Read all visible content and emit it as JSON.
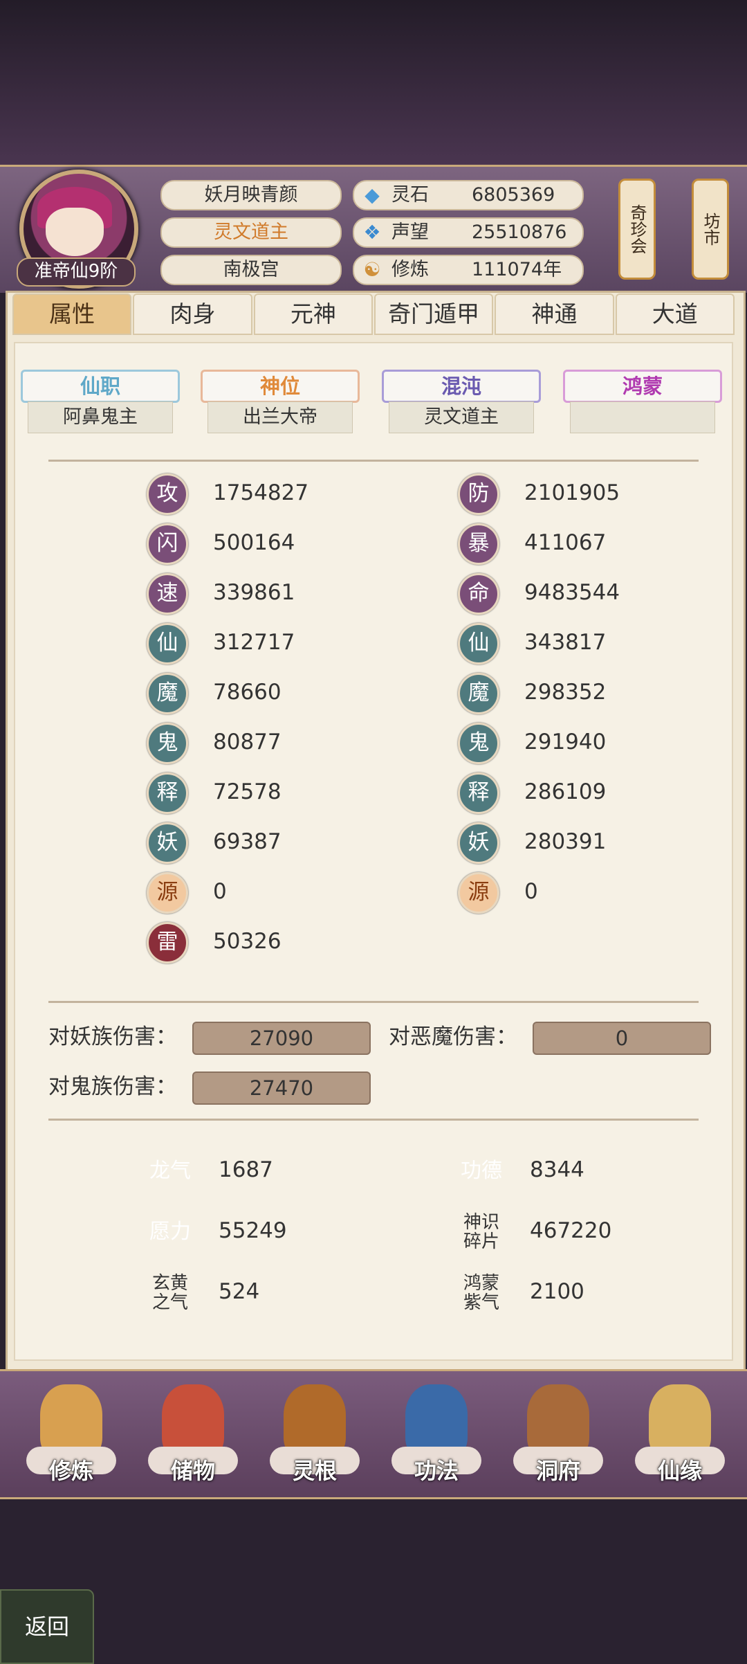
{
  "player": {
    "rank": "准帝仙9阶",
    "name": "妖月映青颜",
    "title": "灵文道主",
    "sect": "南极宫"
  },
  "resources": [
    {
      "icon": "spirit-stone-icon",
      "label": "灵石",
      "value": "6805369"
    },
    {
      "icon": "reputation-icon",
      "label": "声望",
      "value": "25510876"
    },
    {
      "icon": "cultivation-icon",
      "label": "修炼",
      "value": "111074年"
    }
  ],
  "side_buttons": {
    "treasure": "奇珍会",
    "market": "坊市"
  },
  "tabs": [
    "属性",
    "肉身",
    "元神",
    "奇门遁甲",
    "神通",
    "大道"
  ],
  "titles": [
    {
      "label": "仙职",
      "value": "阿鼻鬼主",
      "color": "#5fa8c8"
    },
    {
      "label": "神位",
      "value": "出兰大帝",
      "color": "#e08a3a"
    },
    {
      "label": "混沌",
      "value": "灵文道主",
      "color": "#6a5ab0"
    },
    {
      "label": "鸿蒙",
      "value": "",
      "color": "#b03ab0"
    }
  ],
  "stats_left": [
    {
      "icon": "攻",
      "value": "1754827",
      "style": ""
    },
    {
      "icon": "闪",
      "value": "500164",
      "style": ""
    },
    {
      "icon": "速",
      "value": "339861",
      "style": ""
    },
    {
      "icon": "仙",
      "value": "312717",
      "style": "teal"
    },
    {
      "icon": "魔",
      "value": "78660",
      "style": "teal"
    },
    {
      "icon": "鬼",
      "value": "80877",
      "style": "teal"
    },
    {
      "icon": "释",
      "value": "72578",
      "style": "teal"
    },
    {
      "icon": "妖",
      "value": "69387",
      "style": "teal"
    },
    {
      "icon": "源",
      "value": "0",
      "style": "orange"
    },
    {
      "icon": "雷",
      "value": "50326",
      "style": "red"
    }
  ],
  "stats_right": [
    {
      "icon": "防",
      "value": "2101905",
      "style": ""
    },
    {
      "icon": "暴",
      "value": "411067",
      "style": ""
    },
    {
      "icon": "命",
      "value": "9483544",
      "style": ""
    },
    {
      "icon": "仙",
      "value": "343817",
      "style": "teal"
    },
    {
      "icon": "魔",
      "value": "298352",
      "style": "teal"
    },
    {
      "icon": "鬼",
      "value": "291940",
      "style": "teal"
    },
    {
      "icon": "释",
      "value": "286109",
      "style": "teal"
    },
    {
      "icon": "妖",
      "value": "280391",
      "style": "teal"
    },
    {
      "icon": "源",
      "value": "0",
      "style": "orange"
    }
  ],
  "damage": {
    "vs_yao_label": "对妖族伤害：",
    "vs_yao_value": "27090",
    "vs_demon_label": "对恶魔伤害：",
    "vs_demon_value": "0",
    "vs_ghost_label": "对鬼族伤害：",
    "vs_ghost_value": "27470"
  },
  "misc": [
    {
      "label": "龙气",
      "value": "1687",
      "diamond": true
    },
    {
      "label": "功德",
      "value": "8344",
      "diamond": true
    },
    {
      "label": "愿力",
      "value": "55249",
      "diamond": true
    },
    {
      "label": "神识碎片",
      "value": "467220",
      "diamond": false
    },
    {
      "label": "玄黄之气",
      "value": "524",
      "diamond": false
    },
    {
      "label": "鸿蒙紫气",
      "value": "2100",
      "diamond": false
    }
  ],
  "nav": [
    {
      "label": "修炼",
      "icon": "monk-icon",
      "color": "#d8a050"
    },
    {
      "label": "储物",
      "icon": "bag-icon",
      "color": "#c8503a"
    },
    {
      "label": "灵根",
      "icon": "root-icon",
      "color": "#b06a2a"
    },
    {
      "label": "功法",
      "icon": "book-icon",
      "color": "#3a6aa8"
    },
    {
      "label": "洞府",
      "icon": "house-icon",
      "color": "#a86a3a"
    },
    {
      "label": "仙缘",
      "icon": "gourd-icon",
      "color": "#d8b060"
    }
  ],
  "back_label": "返回"
}
